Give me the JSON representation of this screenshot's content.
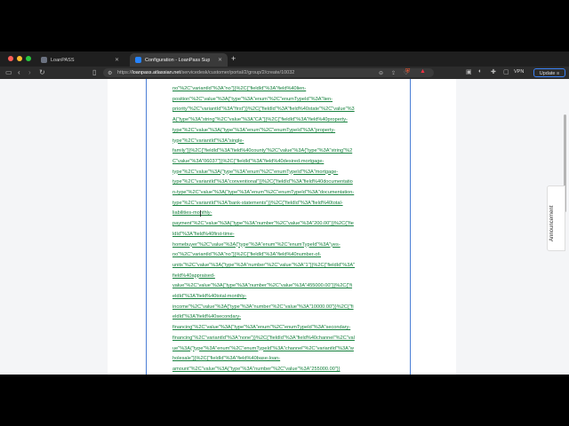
{
  "tabs": [
    {
      "label": "LoanPASS",
      "active": false
    },
    {
      "label": "Configuration - LoanPass Sup",
      "active": true
    }
  ],
  "address_bar": {
    "host": "loanpass.atlassian.net",
    "path": "/servicedesk/customer/portal/2/group/2/create/10032",
    "scheme": "https://"
  },
  "toolbar": {
    "vpn_label": "VPN",
    "update_label": "Update"
  },
  "sidebar_tab": {
    "label": "Announcement"
  },
  "code_lines": [
    "no\"%2C\"variantId\"%3A\"no\"}}%2C{\"fieldId\"%3A\"field%40lien-",
    "position\"%2C\"value\"%3A{\"type\"%3A\"enum\"%2C\"enumTypeId\"%3A\"lien-",
    "priority\"%2C\"variantId\"%3A\"first\"}}%2C{\"fieldId\"%3A\"field%40state\"%2C\"value\"%3",
    "A{\"type\"%3A\"string\"%2C\"value\"%3A\"CA\"}}%2C{\"fieldId\"%3A\"field%40property-",
    "type\"%2C\"value\"%3A{\"type\"%3A\"enum\"%2C\"enumTypeId\"%3A\"property-",
    "type\"%2C\"variantId\"%3A\"single-",
    "family\"}}%2C{\"fieldId\"%3A\"field%40county\"%2C\"value\"%3A{\"type\"%3A\"string\"%2",
    "C\"value\"%3A\"06037\"}}%2C{\"fieldId\"%3A\"field%40desired-mortgage-",
    "type\"%2C\"value\"%3A{\"type\"%3A\"enum\"%2C\"enumTypeId\"%3A\"mortgage-",
    "type\"%2C\"variantId\"%3A\"conventional\"}}%2C{\"fieldId\"%3A\"field%40documentatio",
    "n-type\"%2C\"value\"%3A{\"type\"%3A\"enum\"%2C\"enumTypeId\"%3A\"documentation-",
    "type\"%2C\"variantId\"%3A\"bank-statements\"}}%2C{\"fieldId\"%3A\"field%40total-",
    "liabilities-monthly-",
    "payment\"%2C\"value\"%3A{\"type\"%3A\"number\"%2C\"value\"%3A\"200.00\"}}%2C{\"fie",
    "ldId\"%3A\"field%40first-time-",
    "homebuyer\"%2C\"value\"%3A{\"type\"%3A\"enum\"%2C\"enumTypeId\"%3A\"yes-",
    "no\"%2C\"variantId\"%3A\"no\"}}%2C{\"fieldId\"%3A\"field%40number-of-",
    "units\"%2C\"value\"%3A{\"type\"%3A\"number\"%2C\"value\"%3A\"1\"}}%2C{\"fieldId\"%3A\"",
    "field%40appraised-",
    "value\"%2C\"value\"%3A{\"type\"%3A\"number\"%2C\"value\"%3A\"455000.00\"}}%2C{\"fi",
    "eldId\"%3A\"field%40total-monthly-",
    "income\"%2C\"value\"%3A{\"type\"%3A\"number\"%2C\"value\"%3A\"10000.00\"}}%2C{\"fi",
    "eldId\"%3A\"field%40secondary-",
    "financing\"%2C\"value\"%3A{\"type\"%3A\"enum\"%2C\"enumTypeId\"%3A\"secondary-",
    "financing\"%2C\"variantId\"%3A\"none\"}}%2C{\"fieldId\"%3A\"field%40channel\"%2C\"val",
    "ue\"%3A{\"type\"%3A\"enum\"%2C\"enumTypeId\"%3A\"channel\"%2C\"variantId\"%3A\"w",
    "holesale\"}}%2C{\"fieldId\"%3A\"field%40base-loan-",
    "amount\"%2C\"value\"%3A{\"type\"%3A\"number\"%2C\"value\"%3A\"255000.00\"}}"
  ],
  "colors": {
    "link_green": "#15803d",
    "focus_border": "#4c7fd6",
    "update_border": "#3b82f6"
  }
}
